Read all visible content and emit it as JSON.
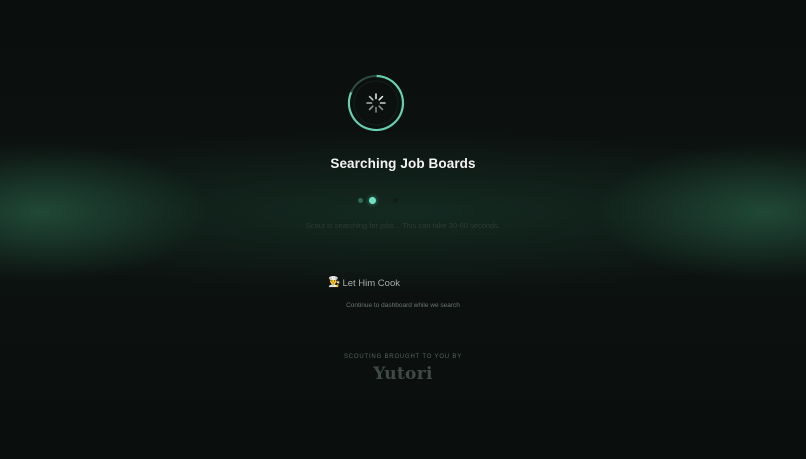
{
  "loader": {
    "icon": "spinner-icon",
    "accent_color": "#6fe3c1",
    "title": "Searching Job Boards",
    "step_current": 2,
    "step_total": 4,
    "subtext": "Scout is searching for jobs... This can take 30-60 seconds."
  },
  "action": {
    "icon": "chef-emoji-icon",
    "emoji": "👨‍🍳",
    "label": "Let Him Cook",
    "caption": "Continue to dashboard while we search"
  },
  "footer": {
    "brought_by": "SCOUTING BROUGHT TO YOU BY",
    "brand": "Yutori"
  }
}
